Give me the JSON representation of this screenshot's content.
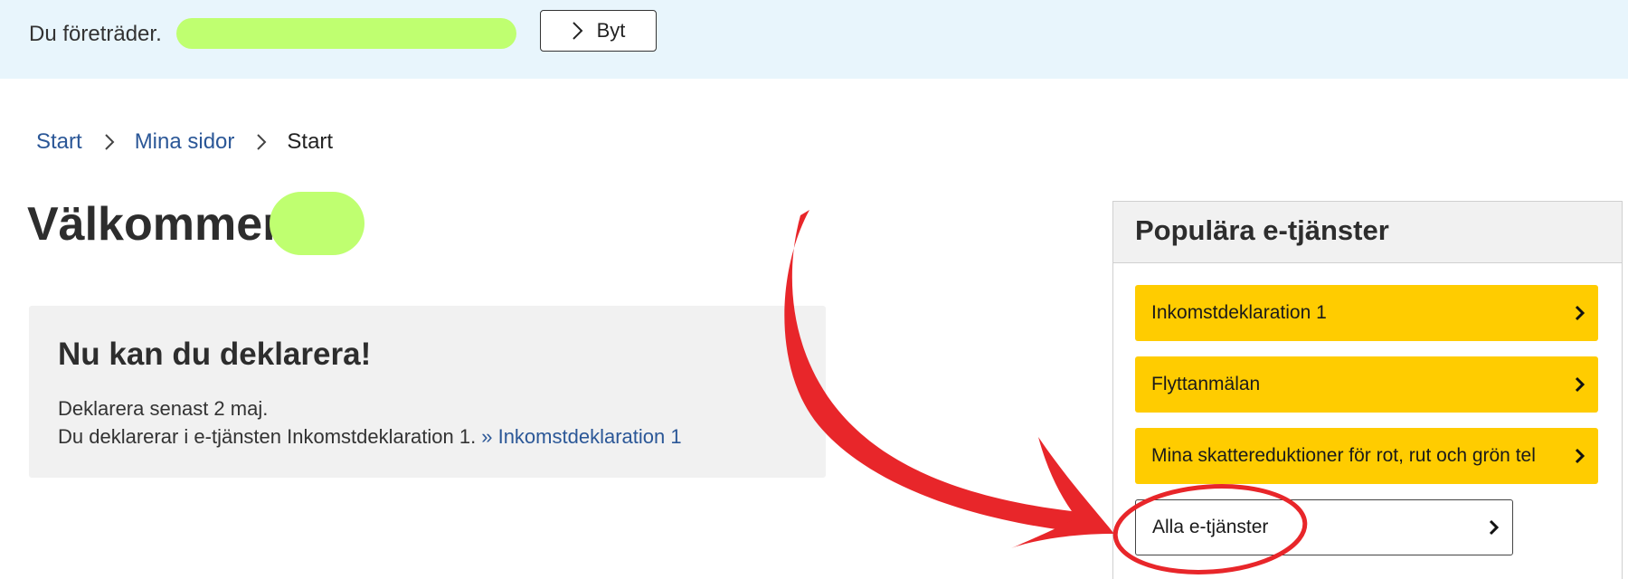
{
  "representative_bar": {
    "text": "Du företräder.",
    "switch_label": "Byt"
  },
  "breadcrumb": {
    "items": [
      "Start",
      "Mina sidor",
      "Start"
    ]
  },
  "page": {
    "title": "Välkommen"
  },
  "notice": {
    "heading": "Nu kan du deklarera!",
    "line1": "Deklarera senast 2 maj.",
    "line2": "Du deklarerar i e-tjänsten Inkomstdeklaration 1.",
    "link_label": "» Inkomstdeklaration 1"
  },
  "popular_services": {
    "heading": "Populära e-tjänster",
    "items": [
      "Inkomstdeklaration 1",
      "Flyttanmälan",
      "Mina skattereduktioner för rot, rut och grön tel"
    ],
    "all_label": "Alla e-tjänster"
  },
  "colors": {
    "banner_bg": "#e8f5fc",
    "link": "#2b5797",
    "service_button": "#ffcc00",
    "annotation": "#e8262a",
    "redaction": "#bfff70"
  }
}
